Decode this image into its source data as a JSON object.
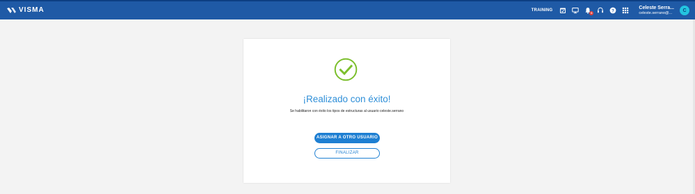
{
  "header": {
    "brand": "VISMA",
    "training_label": "TRAINING",
    "user_name": "Celeste Serra...",
    "user_email": "celeste.serrano@...",
    "avatar_initial": "C",
    "notification_count": "6"
  },
  "icons": [
    "calendar-check-icon",
    "monitor-icon",
    "bell-icon",
    "headset-icon",
    "help-icon",
    "apps-grid-icon"
  ],
  "success": {
    "title": "¡Realizado con éxito!",
    "message": "Se habilitaron con éxito los tipos de estructuras al usuario celeste.serrano",
    "primary_button": "ASIGNAR A OTRO USUARIO",
    "secondary_button": "FINALIZAR"
  },
  "colors": {
    "header": "#1f5aa6",
    "accent": "#1e7fd2",
    "success": "#7cbf2d",
    "avatar": "#23c4e0"
  }
}
